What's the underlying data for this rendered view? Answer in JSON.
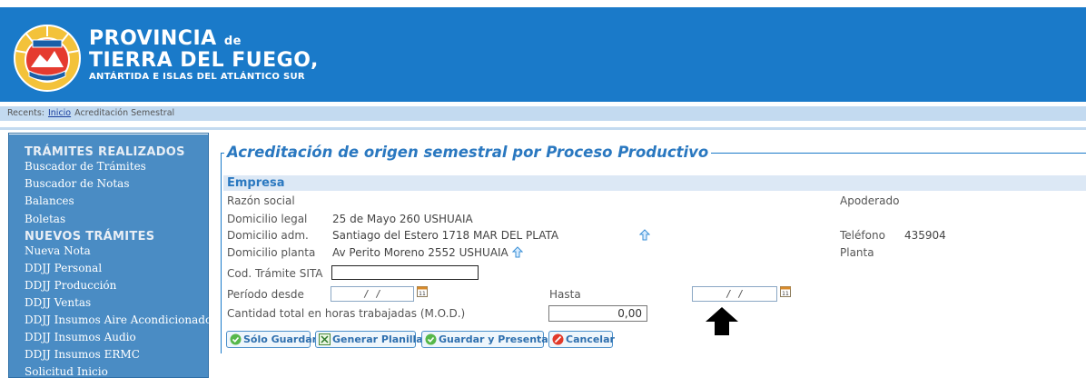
{
  "header": {
    "title_line1": "PROVINCIA",
    "title_de": "de",
    "title_line2": "TIERRA DEL FUEGO,",
    "title_line3": "ANTÁRTIDA E ISLAS DEL ATLÁNTICO SUR",
    "seal_icon": "province-seal-icon",
    "background_color": "#1a7ac9"
  },
  "breadcrumb": {
    "prefix": "Recents:",
    "home": "Inicio",
    "current": "Acreditación Semestral"
  },
  "sidebar": {
    "section1": "TRÁMITES REALIZADOS",
    "items1": [
      "Buscador de Trámites",
      "Buscador de Notas",
      "Balances",
      "Boletas"
    ],
    "section2": "NUEVOS TRÁMITES",
    "items2": [
      "Nueva Nota",
      "DDJJ Personal",
      "DDJJ Producción",
      "DDJJ Ventas",
      "DDJJ Insumos Aire Acondicionado",
      "DDJJ Insumos Audio",
      "DDJJ Insumos ERMC",
      "Solicitud Inicio"
    ]
  },
  "form": {
    "legend": "Acreditación de origen semestral por Proceso Productivo",
    "section": "Empresa",
    "razon_social_label": "Razón social",
    "razon_social_value": "",
    "apoderado_label": "Apoderado",
    "apoderado_value": "",
    "domicilio_legal_label": "Domicilio legal",
    "domicilio_legal_value": "25 de Mayo 260 USHUAIA",
    "domicilio_adm_label": "Domicilio adm.",
    "domicilio_adm_value": "Santiago del Estero 1718 MAR DEL PLATA",
    "telefono_label": "Teléfono",
    "telefono_value": "435904",
    "domicilio_planta_label": "Domicilio planta",
    "domicilio_planta_value": "Av Perito Moreno  2552  USHUAIA",
    "planta_label": "Planta",
    "cod_tramite_label": "Cod. Trámite SITA",
    "cod_tramite_value": "",
    "periodo_desde_label": "Período desde",
    "periodo_desde_value": "/ /",
    "hasta_label": "Hasta",
    "hasta_value": "/ /",
    "cantidad_label": "Cantidad total en horas trabajadas (M.O.D.)",
    "cantidad_value": "0,00"
  },
  "buttons": {
    "solo_guardar": "Sólo Guardar",
    "generar_planilla": "Generar Planilla",
    "guardar_presentar": "Guardar y Presentar",
    "cancelar": "Cancelar"
  },
  "colors": {
    "accent": "#2a78c0",
    "sidebar": "#4a8cc4",
    "crumb_bar": "#c3daf0"
  }
}
